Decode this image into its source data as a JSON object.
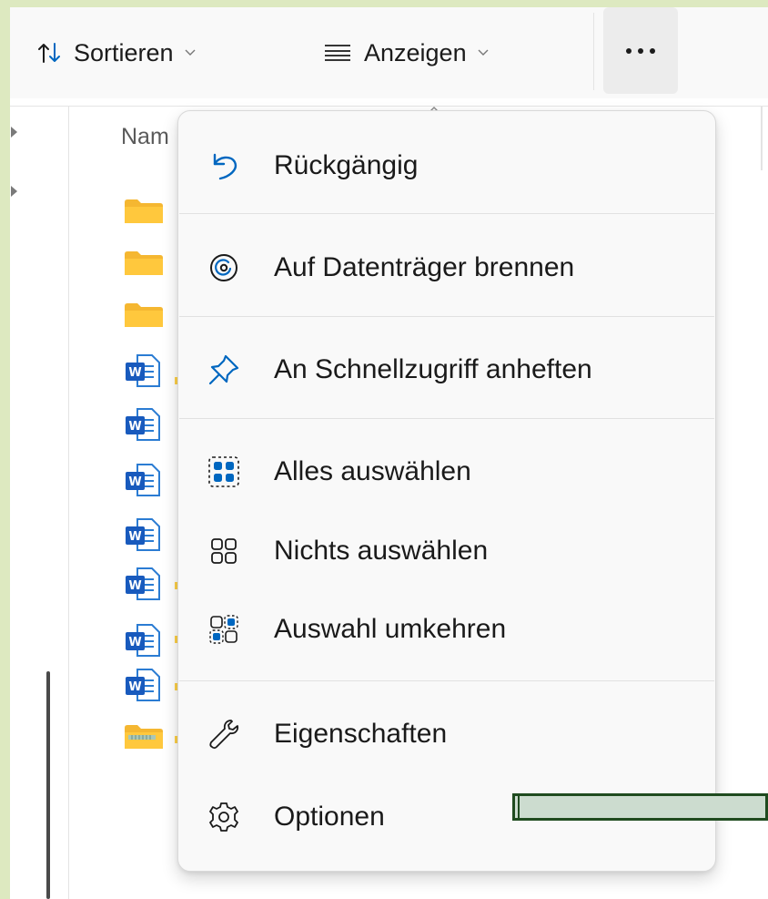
{
  "toolbar": {
    "sort_label": "Sortieren",
    "view_label": "Anzeigen",
    "sort_icon": "sort-arrows-icon",
    "view_icon": "hamburger-lines-icon",
    "more_icon": "more-ellipsis-icon"
  },
  "file_list": {
    "column_header": "Nam",
    "items": [
      {
        "type": "folder",
        "icon": "folder-icon"
      },
      {
        "type": "folder",
        "icon": "folder-icon"
      },
      {
        "type": "folder",
        "icon": "folder-icon"
      },
      {
        "type": "word",
        "icon": "word-document-icon"
      },
      {
        "type": "word",
        "icon": "word-document-icon"
      },
      {
        "type": "word",
        "icon": "word-document-icon"
      },
      {
        "type": "word",
        "icon": "word-document-icon"
      },
      {
        "type": "word",
        "icon": "word-document-icon"
      },
      {
        "type": "word",
        "icon": "word-document-icon"
      },
      {
        "type": "word",
        "icon": "word-document-icon"
      },
      {
        "type": "zip",
        "icon": "zip-folder-icon"
      }
    ]
  },
  "menu": {
    "items": [
      {
        "label": "Rückgängig",
        "icon": "undo-icon"
      },
      {
        "label": "Auf Datenträger brennen",
        "icon": "burn-disc-icon"
      },
      {
        "label": "An Schnellzugriff anheften",
        "icon": "pin-icon"
      },
      {
        "label": "Alles auswählen",
        "icon": "select-all-icon"
      },
      {
        "label": "Nichts auswählen",
        "icon": "select-none-icon"
      },
      {
        "label": "Auswahl umkehren",
        "icon": "invert-selection-icon"
      },
      {
        "label": "Eigenschaften",
        "icon": "wrench-icon"
      },
      {
        "label": "Optionen",
        "icon": "gear-icon"
      }
    ]
  },
  "colors": {
    "accent": "#0067c0",
    "menu_bg": "#f9f9f9",
    "folder": "#ffc83d",
    "word": "#185abd",
    "side_green": "#dde9c0"
  }
}
